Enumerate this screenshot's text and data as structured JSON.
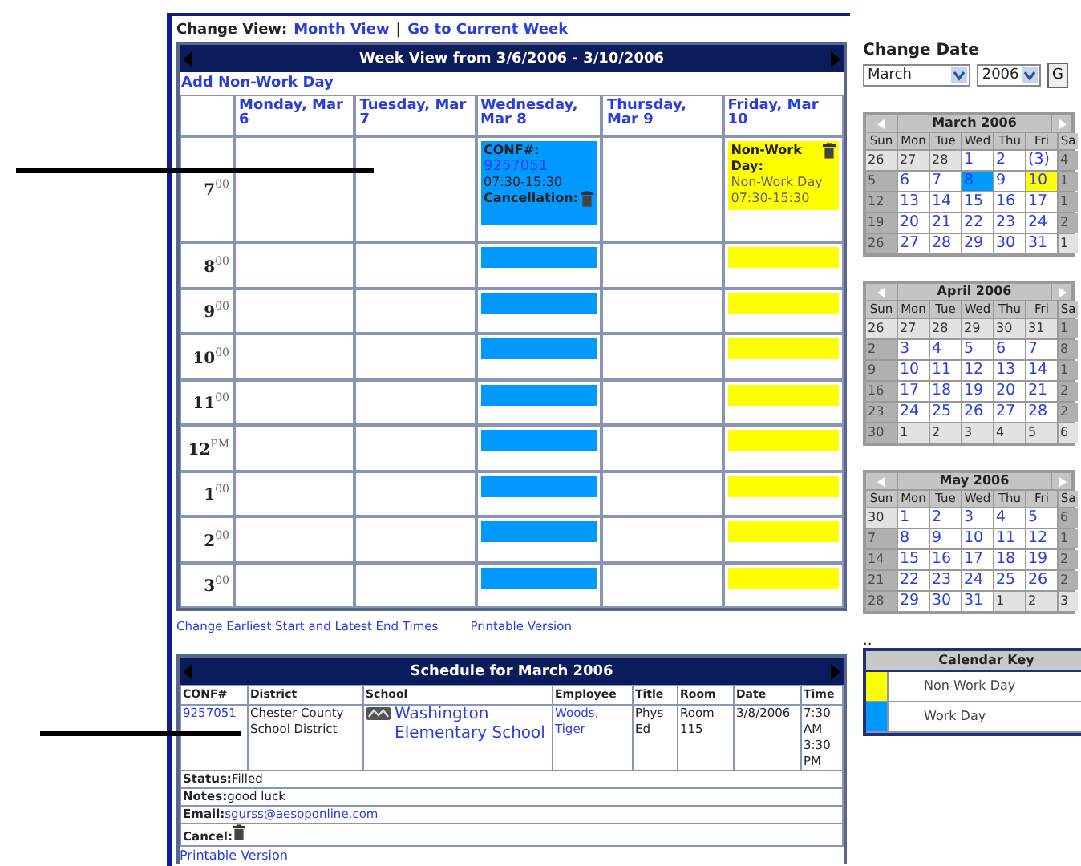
{
  "change_view": {
    "label": "Change View:",
    "links": [
      "Month View",
      "Go to Current Week"
    ],
    "separator": "|"
  },
  "week_view": {
    "title": "Week View from 3/6/2006 - 3/10/2006",
    "add_link": "Add Non-Work Day",
    "hours": [
      "7$^{00}$",
      "8$^{00}$",
      "9$^{00}$",
      "10$^{00}$",
      "11$^{00}$",
      "12$^{PM}$",
      "1$^{00}$",
      "2$^{00}$",
      "3$^{00}$"
    ],
    "days": [
      {
        "label": "Monday, Mar 6"
      },
      {
        "label": "Tuesday, Mar 7"
      },
      {
        "label": "Wednesday, Mar 8",
        "event": {
          "kind": "work",
          "title": "CONF#:",
          "conf": "9257051",
          "time": "07:30-15:30",
          "action": "Cancellation:"
        }
      },
      {
        "label": "Thursday, Mar 9"
      },
      {
        "label": "Friday, Mar 10",
        "event": {
          "kind": "nonwork",
          "title": "Non-Work Day:",
          "note": "Non-Work Day",
          "time": "07:30-15:30"
        }
      }
    ],
    "links": [
      "Change Earliest Start and Latest End Times",
      "Printable Version"
    ]
  },
  "schedule": {
    "title": "Schedule for March 2006",
    "columns": [
      "CONF#",
      "District",
      "School",
      "Employee",
      "Title",
      "Room",
      "Date",
      "Time"
    ],
    "row": {
      "conf": "9257051",
      "district": "Chester County School District",
      "school": "Washington Elementary School",
      "employee": "Woods, Tiger",
      "title": "Phys Ed",
      "room": "Room 115",
      "date": "3/8/2006",
      "time": "7:30 AM 3:30 PM"
    },
    "details": [
      {
        "kind": "text",
        "label": "Status:",
        "value": "Filled"
      },
      {
        "kind": "text",
        "label": "Notes:",
        "value": "good luck"
      },
      {
        "kind": "link",
        "label": "Email:",
        "value": "sgurss@aesoponline.com"
      },
      {
        "kind": "trash",
        "label": "Cancel:"
      }
    ],
    "printable": "Printable Version"
  },
  "change_date": {
    "title": "Change Date",
    "month": "March",
    "year": "2006",
    "go": "G"
  },
  "mini_calendars": [
    {
      "title": "March 2006",
      "weekdays": [
        "Sun",
        "Mon",
        "Tue",
        "Wed",
        "Thu",
        "Fri",
        "Sa"
      ],
      "weeks": [
        [
          {
            "day": "26",
            "kind": "other"
          },
          {
            "day": "27",
            "kind": "other"
          },
          {
            "day": "28",
            "kind": "other"
          },
          {
            "day": "1",
            "kind": "day"
          },
          {
            "day": "2",
            "kind": "day"
          },
          {
            "day": "(3)",
            "kind": "day"
          },
          {
            "day": "4",
            "kind": "weekend"
          }
        ],
        [
          {
            "day": "5",
            "kind": "weekend"
          },
          {
            "day": "6",
            "kind": "day"
          },
          {
            "day": "7",
            "kind": "day"
          },
          {
            "day": "8",
            "kind": "selected"
          },
          {
            "day": "9",
            "kind": "day"
          },
          {
            "day": "10",
            "kind": "nonwork"
          },
          {
            "day": "1",
            "kind": "weekend"
          }
        ],
        [
          {
            "day": "12",
            "kind": "weekend"
          },
          {
            "day": "13",
            "kind": "day"
          },
          {
            "day": "14",
            "kind": "day"
          },
          {
            "day": "15",
            "kind": "day"
          },
          {
            "day": "16",
            "kind": "day"
          },
          {
            "day": "17",
            "kind": "day"
          },
          {
            "day": "1",
            "kind": "weekend"
          }
        ],
        [
          {
            "day": "19",
            "kind": "weekend"
          },
          {
            "day": "20",
            "kind": "day"
          },
          {
            "day": "21",
            "kind": "day"
          },
          {
            "day": "22",
            "kind": "day"
          },
          {
            "day": "23",
            "kind": "day"
          },
          {
            "day": "24",
            "kind": "day"
          },
          {
            "day": "2",
            "kind": "weekend"
          }
        ],
        [
          {
            "day": "26",
            "kind": "weekend"
          },
          {
            "day": "27",
            "kind": "day"
          },
          {
            "day": "28",
            "kind": "day"
          },
          {
            "day": "29",
            "kind": "day"
          },
          {
            "day": "30",
            "kind": "day"
          },
          {
            "day": "31",
            "kind": "day"
          },
          {
            "day": "1",
            "kind": "other"
          }
        ]
      ]
    },
    {
      "title": "April 2006",
      "weekdays": [
        "Sun",
        "Mon",
        "Tue",
        "Wed",
        "Thu",
        "Fri",
        "Sa"
      ],
      "weeks": [
        [
          {
            "day": "26",
            "kind": "other"
          },
          {
            "day": "27",
            "kind": "other"
          },
          {
            "day": "28",
            "kind": "other"
          },
          {
            "day": "29",
            "kind": "other"
          },
          {
            "day": "30",
            "kind": "other"
          },
          {
            "day": "31",
            "kind": "other"
          },
          {
            "day": "1",
            "kind": "weekend"
          }
        ],
        [
          {
            "day": "2",
            "kind": "weekend"
          },
          {
            "day": "3",
            "kind": "day"
          },
          {
            "day": "4",
            "kind": "day"
          },
          {
            "day": "5",
            "kind": "day"
          },
          {
            "day": "6",
            "kind": "day"
          },
          {
            "day": "7",
            "kind": "day"
          },
          {
            "day": "8",
            "kind": "weekend"
          }
        ],
        [
          {
            "day": "9",
            "kind": "weekend"
          },
          {
            "day": "10",
            "kind": "day"
          },
          {
            "day": "11",
            "kind": "day"
          },
          {
            "day": "12",
            "kind": "day"
          },
          {
            "day": "13",
            "kind": "day"
          },
          {
            "day": "14",
            "kind": "day"
          },
          {
            "day": "1",
            "kind": "weekend"
          }
        ],
        [
          {
            "day": "16",
            "kind": "weekend"
          },
          {
            "day": "17",
            "kind": "day"
          },
          {
            "day": "18",
            "kind": "day"
          },
          {
            "day": "19",
            "kind": "day"
          },
          {
            "day": "20",
            "kind": "day"
          },
          {
            "day": "21",
            "kind": "day"
          },
          {
            "day": "2",
            "kind": "weekend"
          }
        ],
        [
          {
            "day": "23",
            "kind": "weekend"
          },
          {
            "day": "24",
            "kind": "day"
          },
          {
            "day": "25",
            "kind": "day"
          },
          {
            "day": "26",
            "kind": "day"
          },
          {
            "day": "27",
            "kind": "day"
          },
          {
            "day": "28",
            "kind": "day"
          },
          {
            "day": "2",
            "kind": "weekend"
          }
        ],
        [
          {
            "day": "30",
            "kind": "weekend"
          },
          {
            "day": "1",
            "kind": "other"
          },
          {
            "day": "2",
            "kind": "other"
          },
          {
            "day": "3",
            "kind": "other"
          },
          {
            "day": "4",
            "kind": "other"
          },
          {
            "day": "5",
            "kind": "other"
          },
          {
            "day": "6",
            "kind": "other"
          }
        ]
      ]
    },
    {
      "title": "May 2006",
      "weekdays": [
        "Sun",
        "Mon",
        "Tue",
        "Wed",
        "Thu",
        "Fri",
        "Sa"
      ],
      "weeks": [
        [
          {
            "day": "30",
            "kind": "other"
          },
          {
            "day": "1",
            "kind": "day"
          },
          {
            "day": "2",
            "kind": "day"
          },
          {
            "day": "3",
            "kind": "day"
          },
          {
            "day": "4",
            "kind": "day"
          },
          {
            "day": "5",
            "kind": "day"
          },
          {
            "day": "6",
            "kind": "weekend"
          }
        ],
        [
          {
            "day": "7",
            "kind": "weekend"
          },
          {
            "day": "8",
            "kind": "day"
          },
          {
            "day": "9",
            "kind": "day"
          },
          {
            "day": "10",
            "kind": "day"
          },
          {
            "day": "11",
            "kind": "day"
          },
          {
            "day": "12",
            "kind": "day"
          },
          {
            "day": "1",
            "kind": "weekend"
          }
        ],
        [
          {
            "day": "14",
            "kind": "weekend"
          },
          {
            "day": "15",
            "kind": "day"
          },
          {
            "day": "16",
            "kind": "day"
          },
          {
            "day": "17",
            "kind": "day"
          },
          {
            "day": "18",
            "kind": "day"
          },
          {
            "day": "19",
            "kind": "day"
          },
          {
            "day": "2",
            "kind": "weekend"
          }
        ],
        [
          {
            "day": "21",
            "kind": "weekend"
          },
          {
            "day": "22",
            "kind": "day"
          },
          {
            "day": "23",
            "kind": "day"
          },
          {
            "day": "24",
            "kind": "day"
          },
          {
            "day": "25",
            "kind": "day"
          },
          {
            "day": "26",
            "kind": "day"
          },
          {
            "day": "2",
            "kind": "weekend"
          }
        ],
        [
          {
            "day": "28",
            "kind": "weekend"
          },
          {
            "day": "29",
            "kind": "day"
          },
          {
            "day": "30",
            "kind": "day"
          },
          {
            "day": "31",
            "kind": "day"
          },
          {
            "day": "1",
            "kind": "other"
          },
          {
            "day": "2",
            "kind": "other"
          },
          {
            "day": "3",
            "kind": "other"
          }
        ]
      ]
    }
  ],
  "dots": "..",
  "calendar_key": {
    "title": "Calendar Key",
    "items": [
      {
        "color": "#ffff00",
        "label": "Non-Work Day"
      },
      {
        "color": "#0099ff",
        "label": "Work Day"
      }
    ]
  }
}
